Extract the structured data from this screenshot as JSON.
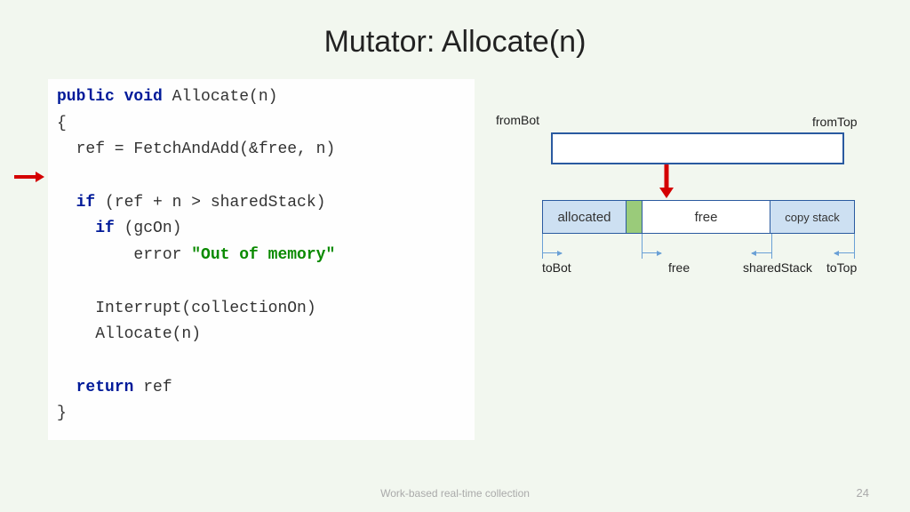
{
  "title": "Mutator: Allocate(n)",
  "code": {
    "kw_public": "public",
    "kw_void": "void",
    "fn_name": " Allocate(n)",
    "open": "{",
    "l_ref": "  ref = FetchAndAdd(&free, n)",
    "kw_if1": "if",
    "l_if1_rest": " (ref + n > sharedStack)",
    "kw_if2": "if",
    "l_if2_rest": " (gcOn)",
    "l_err_pre": "        error ",
    "str_oom": "\"Out of memory\"",
    "l_int": "    Interrupt(collectionOn)",
    "l_alloc": "    Allocate(n)",
    "kw_return": "return",
    "l_ret_rest": " ref",
    "close": "}"
  },
  "diagram": {
    "fromBot": "fromBot",
    "fromTop": "fromTop",
    "allocated": "allocated",
    "free_seg": "free",
    "copy_stack": "copy stack",
    "toBot": "toBot",
    "free_lbl": "free",
    "sharedStack": "sharedStack",
    "toTop": "toTop"
  },
  "footer": "Work-based real-time collection",
  "page": "24"
}
